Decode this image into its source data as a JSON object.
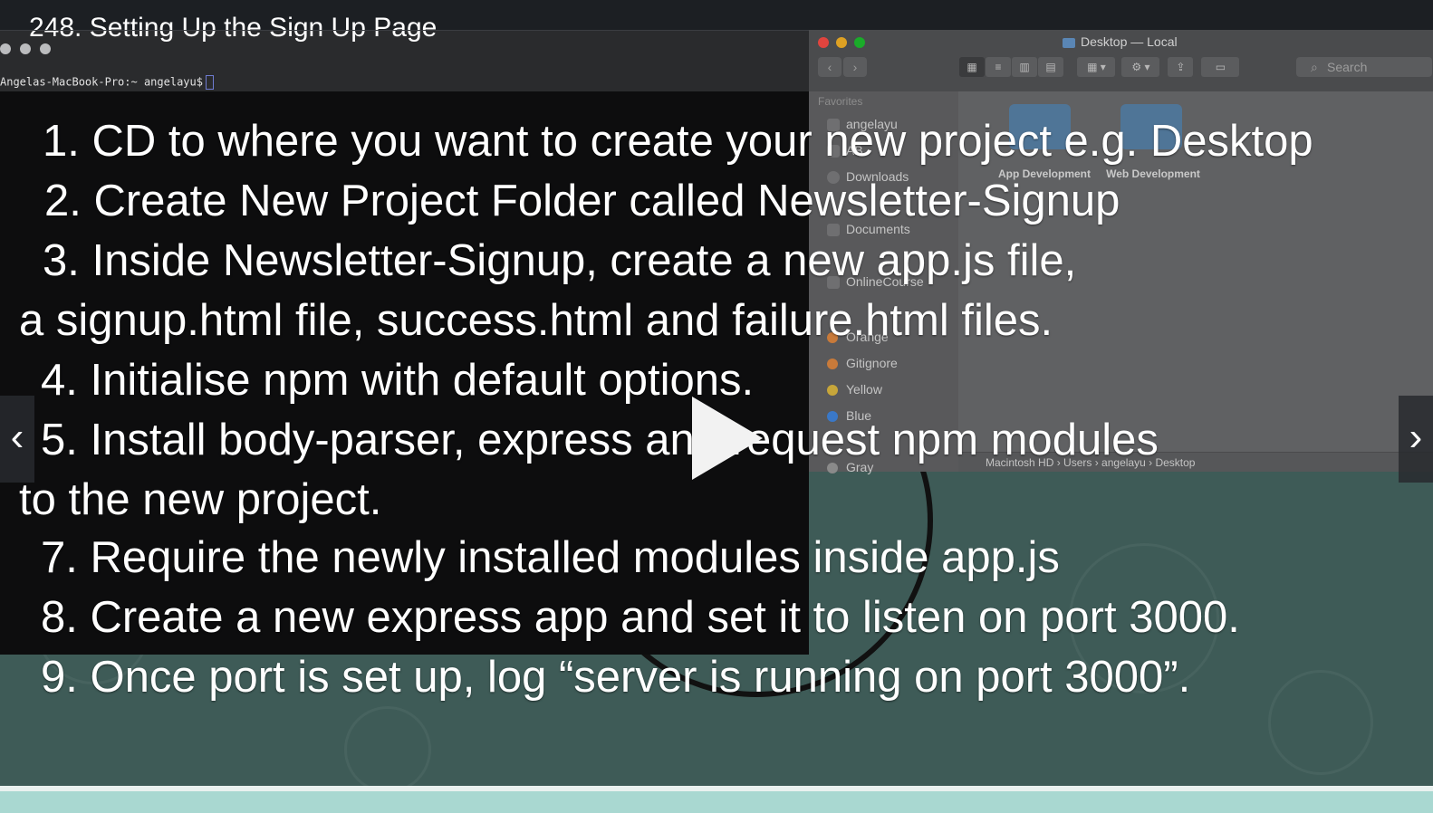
{
  "video": {
    "title": "248. Setting Up the Sign Up Page"
  },
  "terminal": {
    "prompt": "Angelas-MacBook-Pro:~ angelayu$"
  },
  "finder": {
    "window_title": "Desktop — Local",
    "search_placeholder": "Search",
    "sidebar_heading": "Favorites",
    "sidebar_items": [
      "angelayu",
      "AB",
      "Downloads",
      "Documents",
      "OnlineCourse"
    ],
    "tags": [
      {
        "label": "Orange",
        "color": "#c87a3a"
      },
      {
        "label": "Gitignore",
        "color": "#c87a3a"
      },
      {
        "label": "Yellow",
        "color": "#c7a63a"
      },
      {
        "label": "Blue",
        "color": "#3a78c7"
      },
      {
        "label": "Gray",
        "color": "#8a8a8a"
      }
    ],
    "folders": [
      "App Development",
      "Web Development"
    ],
    "path": [
      "Macintosh HD",
      "Users",
      "angelayu",
      "Desktop"
    ]
  },
  "steps": [
    "1. CD to where you want to create your new project e.g. Desktop",
    "2. Create New Project Folder called Newsletter-Signup",
    "3. Inside Newsletter-Signup, create a new app.js file,",
    "a signup.html file, success.html and failure.html files.",
    "4. Initialise npm with default options.",
    "5. Install body-parser, express and request npm modules",
    "to the new project.",
    "7. Require the newly installed modules inside app.js",
    "8. Create a new express app and set it to listen on port 3000.",
    "9. Once port is set up, log “server is running on port 3000”."
  ],
  "controls": {
    "prev": "‹",
    "next": "›"
  }
}
